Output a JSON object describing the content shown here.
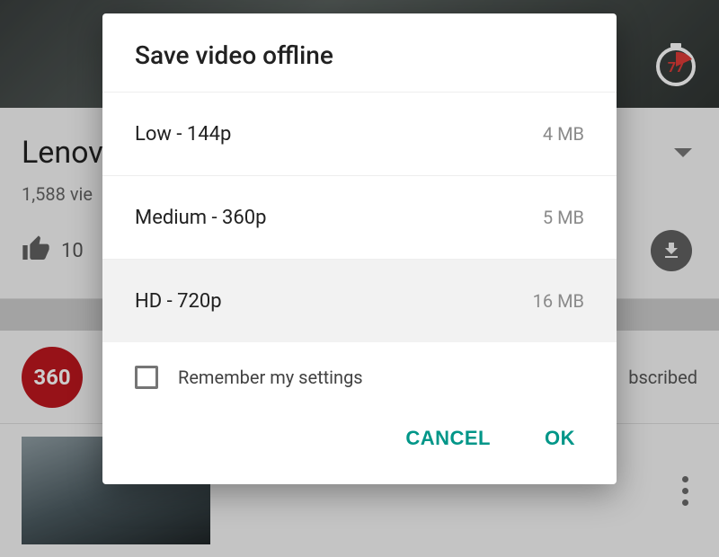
{
  "background": {
    "timer_value": "77",
    "title_truncated": "Lenov",
    "views_truncated": "1,588 vie",
    "like_count": "10",
    "channel_logo_text": "360",
    "subscribed_truncated": "bscribed"
  },
  "dialog": {
    "title": "Save video offline",
    "options": [
      {
        "label": "Low - 144p",
        "size": "4 MB",
        "selected": false
      },
      {
        "label": "Medium - 360p",
        "size": "5 MB",
        "selected": false
      },
      {
        "label": "HD - 720p",
        "size": "16 MB",
        "selected": true
      }
    ],
    "remember_label": "Remember my settings",
    "remember_checked": false,
    "cancel_label": "CANCEL",
    "ok_label": "OK"
  },
  "colors": {
    "accent": "#009688"
  }
}
